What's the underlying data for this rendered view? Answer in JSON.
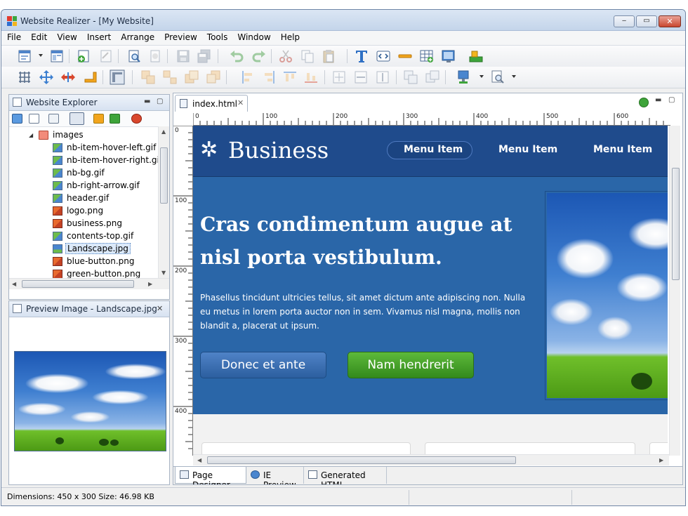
{
  "window": {
    "title": "Website Realizer - [My Website]",
    "controls": {
      "minimize": "‒",
      "maximize": "▭",
      "close": "✕"
    }
  },
  "menu": [
    "File",
    "Edit",
    "View",
    "Insert",
    "Arrange",
    "Preview",
    "Tools",
    "Window",
    "Help"
  ],
  "explorer": {
    "title": "Website Explorer",
    "folder": "images",
    "files": [
      {
        "name": "nb-item-hover-left.gif",
        "kind": "gif"
      },
      {
        "name": "nb-item-hover-right.gif",
        "kind": "gif"
      },
      {
        "name": "nb-bg.gif",
        "kind": "gif"
      },
      {
        "name": "nb-right-arrow.gif",
        "kind": "gif"
      },
      {
        "name": "header.gif",
        "kind": "gif"
      },
      {
        "name": "logo.png",
        "kind": "png"
      },
      {
        "name": "business.png",
        "kind": "png"
      },
      {
        "name": "contents-top.gif",
        "kind": "gif"
      },
      {
        "name": "Landscape.jpg",
        "kind": "jpg",
        "selected": true
      },
      {
        "name": "blue-button.png",
        "kind": "png"
      },
      {
        "name": "green-button.png",
        "kind": "png"
      }
    ]
  },
  "preview_panel": {
    "title": "Preview Image - Landscape.jpg"
  },
  "editor": {
    "tab": "index.html",
    "ruler_h": [
      "0",
      "100",
      "200",
      "300",
      "400",
      "500",
      "600"
    ],
    "ruler_v": [
      "0",
      "100",
      "200",
      "300",
      "400"
    ],
    "bottom_tabs": [
      "Page Designer",
      "IE Preview",
      "Generated HTML"
    ]
  },
  "site": {
    "logo": "Business",
    "nav": [
      "Menu Item",
      "Menu Item",
      "Menu Item"
    ],
    "heading": "Cras condimentum augue at nisl porta vestibulum.",
    "body": "Phasellus tincidunt ultricies tellus, sit amet dictum ante adipiscing non. Nulla eu metus in lorem porta auctor non in sem. Vivamus nisl magna, mollis non blandit a, placerat ut ipsum.",
    "button_blue": "Donec et ante",
    "button_green": "Nam hendrerit"
  },
  "status": {
    "text": "Dimensions: 450 x 300 Size: 46.98 KB"
  },
  "colors": {
    "site_header": "#1f4b8c",
    "site_hero": "#2a66a8",
    "button_green": "#4aa52b",
    "button_blue": "#3a6fb3"
  }
}
